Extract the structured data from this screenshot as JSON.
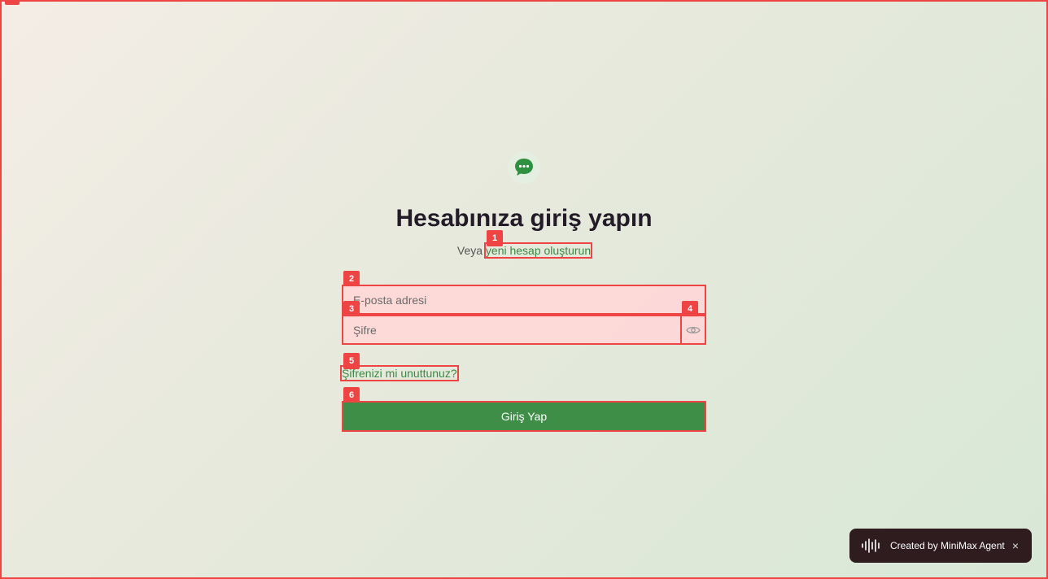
{
  "page": {
    "title": "Hesabınıza giriş yapın",
    "subtitle_prefix": "Veya",
    "signup_link": "yeni hesap oluşturun"
  },
  "form": {
    "email_placeholder": "E-posta adresi",
    "password_placeholder": "Şifre",
    "forgot_link": "Şifrenizi mi unuttunuz?",
    "submit_label": "Giriş Yap"
  },
  "badges": [
    "1",
    "2",
    "3",
    "4",
    "5",
    "6"
  ],
  "toast": {
    "text": "Created by MiniMax Agent",
    "close": "×"
  },
  "colors": {
    "accent": "#3e8e48",
    "highlight": "#ef4444",
    "toast_bg": "#2e1c1e"
  }
}
